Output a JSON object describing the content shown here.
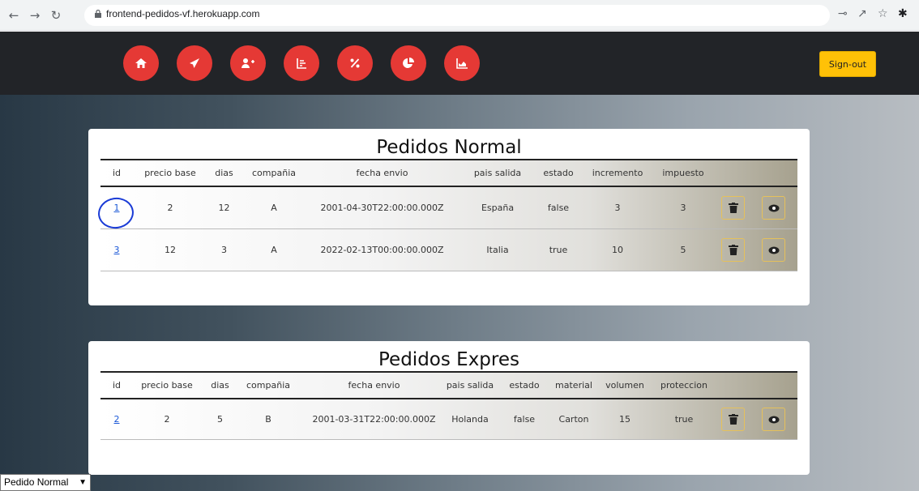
{
  "browser": {
    "url": "frontend-pedidos-vf.herokuapp.com"
  },
  "topbar": {
    "nav_icons": [
      "home-icon",
      "send-icon",
      "user-plus-icon",
      "list-chart-icon",
      "percent-icon",
      "pie-chart-icon",
      "area-chart-icon"
    ],
    "signout_label": "Sign-out"
  },
  "normal": {
    "title": "Pedidos Normal",
    "headers": [
      "id",
      "precio base",
      "dias",
      "compañia",
      "fecha envio",
      "pais salida",
      "estado",
      "incremento",
      "impuesto"
    ],
    "rows": [
      {
        "id": "1",
        "precio_base": "2",
        "dias": "12",
        "compania": "A",
        "fecha_envio": "2001-04-30T22:00:00.000Z",
        "pais_salida": "España",
        "estado": "false",
        "incremento": "3",
        "impuesto": "3"
      },
      {
        "id": "3",
        "precio_base": "12",
        "dias": "3",
        "compania": "A",
        "fecha_envio": "2022-02-13T00:00:00.000Z",
        "pais_salida": "Italia",
        "estado": "true",
        "incremento": "10",
        "impuesto": "5"
      }
    ]
  },
  "expres": {
    "title": "Pedidos Expres",
    "headers": [
      "id",
      "precio base",
      "dias",
      "compañia",
      "fecha envio",
      "pais salida",
      "estado",
      "material",
      "volumen",
      "proteccion"
    ],
    "rows": [
      {
        "id": "2",
        "precio_base": "2",
        "dias": "5",
        "compania": "B",
        "fecha_envio": "2001-03-31T22:00:00.000Z",
        "pais_salida": "Holanda",
        "estado": "false",
        "material": "Carton",
        "volumen": "15",
        "proteccion": "true"
      }
    ]
  },
  "selector": {
    "value": "Pedido Normal"
  },
  "colors": {
    "nav_button": "#e53935",
    "signout": "#ffc107",
    "topbar": "#222428",
    "link": "#1a57d6"
  }
}
